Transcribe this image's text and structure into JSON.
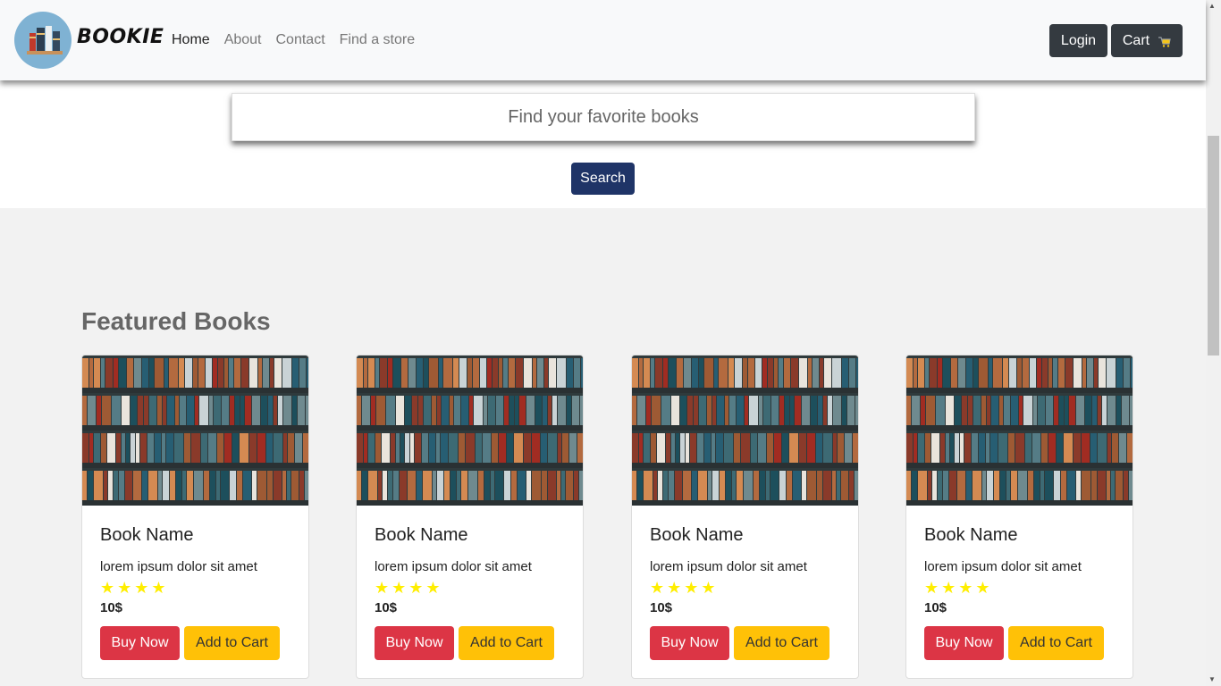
{
  "brand": {
    "name": "BOOKIE"
  },
  "nav": {
    "links": [
      {
        "label": "Home",
        "active": true
      },
      {
        "label": "About"
      },
      {
        "label": "Contact"
      },
      {
        "label": "Find a store"
      }
    ],
    "login_label": "Login",
    "cart_label": "Cart",
    "cart_icon": "cart-icon"
  },
  "search": {
    "placeholder": "Find your favorite books",
    "button_label": "Search"
  },
  "featured": {
    "title": "Featured Books",
    "books": [
      {
        "name": "Book Name",
        "description": "lorem ipsum dolor sit amet",
        "rating": 4,
        "price": "10$",
        "buy_label": "Buy Now",
        "cart_label": "Add to Cart"
      },
      {
        "name": "Book Name",
        "description": "lorem ipsum dolor sit amet",
        "rating": 4,
        "price": "10$",
        "buy_label": "Buy Now",
        "cart_label": "Add to Cart"
      },
      {
        "name": "Book Name",
        "description": "lorem ipsum dolor sit amet",
        "rating": 4,
        "price": "10$",
        "buy_label": "Buy Now",
        "cart_label": "Add to Cart"
      },
      {
        "name": "Book Name",
        "description": "lorem ipsum dolor sit amet",
        "rating": 4,
        "price": "10$",
        "buy_label": "Buy Now",
        "cart_label": "Add to Cart"
      }
    ]
  },
  "colors": {
    "primary_button": "#1f3467",
    "danger": "#dc3545",
    "warning": "#ffc107",
    "dark": "#343a40",
    "star": "#ffee00"
  }
}
